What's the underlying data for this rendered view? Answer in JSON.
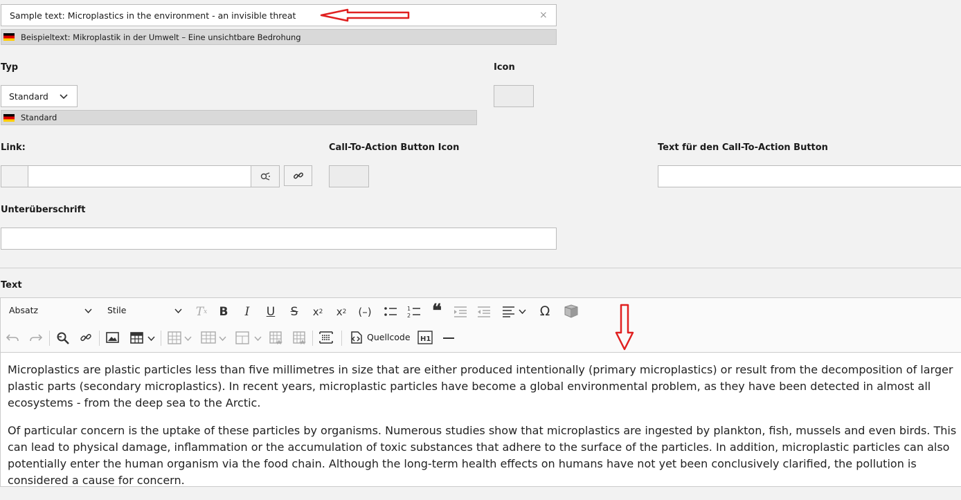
{
  "title_field": {
    "value": "Sample text: Microplastics in the environment - an invisible threat",
    "translation": "Beispieltext: Mikroplastik in der Umwelt – Eine unsichtbare Bedrohung",
    "clear": "×"
  },
  "typ": {
    "label": "Typ",
    "selected": "Standard",
    "translation": "Standard"
  },
  "icon": {
    "label": "Icon"
  },
  "link": {
    "label": "Link:",
    "value": ""
  },
  "cta_icon": {
    "label": "Call-To-Action Button Icon"
  },
  "cta_text": {
    "label": "Text für den Call-To-Action Button",
    "value": ""
  },
  "subheading": {
    "label": "Unterüberschrift",
    "value": ""
  },
  "text_section": {
    "label": "Text"
  },
  "toolbar": {
    "format": "Absatz",
    "styles": "Stile",
    "source_label": "Quellcode"
  },
  "content": {
    "p1": "Microplastics are plastic particles less than five millimetres in size that are either produced intentionally (primary microplastics) or result from the decomposition of larger plastic parts (secondary microplastics). In recent years, microplastic particles have become a global environmental problem, as they have been detected in almost all ecosystems - from the deep sea to the Arctic.",
    "p2": "Of particular concern is the uptake of these particles by organisms. Numerous studies show that microplastics are ingested by plankton, fish, mussels and even birds. This can lead to physical damage, inflammation or the accumulation of toxic substances that adhere to the surface of the particles. In addition, microplastic particles can also potentially enter the human organism via the food chain. Although the long-term health effects on humans have not yet been conclusively clarified, the pollution is considered a cause for concern."
  },
  "colors": {
    "annotation": "#e02020",
    "accent": "#222222"
  }
}
